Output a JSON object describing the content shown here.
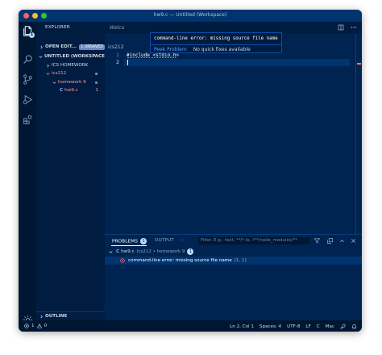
{
  "window": {
    "title": "hw9.c — Untitled (Workspace)"
  },
  "activity_bar": {
    "explorer_badge": "1",
    "icons": [
      "files-icon",
      "search-icon",
      "source-control-icon",
      "run-debug-icon",
      "extensions-icon",
      "settings-gear-icon"
    ]
  },
  "sidebar": {
    "title": "EXPLORER",
    "open_editors": {
      "label": "OPEN EDIT...",
      "badge": "1 UNSAVED"
    },
    "workspace": {
      "label": "UNTITLED (WORKSPACE)"
    },
    "tree": [
      {
        "label": "ICS HOMEWORK",
        "expanded": false
      },
      {
        "label": "ics212",
        "expanded": true
      },
      {
        "label": "homework 9",
        "expanded": true
      },
      {
        "label": "hw9.c",
        "icon": "C",
        "count": "1"
      }
    ],
    "outline_label": "OUTLINE"
  },
  "editor": {
    "tab_label": "Welco",
    "breadcrumb": "ics212",
    "line_numbers": [
      "1",
      "2"
    ],
    "code_lines": [
      "#include <stdio.h>",
      ""
    ]
  },
  "hover": {
    "message": "command-line error: missing source file name",
    "peek_label": "Peek Problem",
    "no_fixes": "No quick fixes available"
  },
  "panel": {
    "tabs": [
      {
        "label": "PROBLEMS",
        "badge": "1",
        "active": true
      },
      {
        "label": "OUTPUT",
        "active": false
      }
    ],
    "more": "···",
    "filter_placeholder": "Filter. E.g.: text, **/*.ts, !**/node_modules/**",
    "file_row": {
      "icon": "C",
      "name": "hw9.c",
      "path": "ics212 • homework 9",
      "count": "1"
    },
    "problems": [
      {
        "severity": "error",
        "message": "command-line error: missing source file name",
        "location": "[1, 1]"
      }
    ]
  },
  "statusbar": {
    "errors": "1",
    "warnings": "0",
    "position": "Ln 2, Col 1",
    "spaces": "Spaces: 4",
    "encoding": "UTF-8",
    "eol": "LF",
    "language": "C",
    "platform": "Mac"
  },
  "colors": {
    "bg": "#002451",
    "sidebar": "#001c40",
    "accent": "#bbdaff",
    "error": "#ff9da4"
  }
}
